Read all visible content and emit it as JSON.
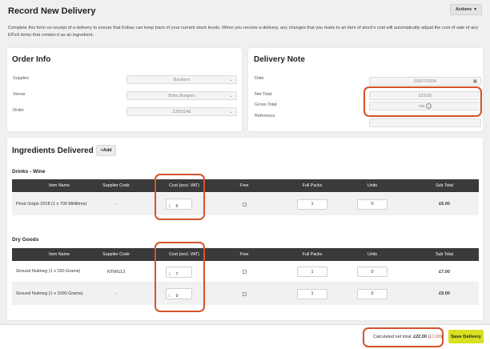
{
  "page": {
    "title": "Record New Delivery",
    "actions_label": "Actions",
    "intro": "Complete this form on receipt of a delivery to ensure that Kobas can keep track of your current stock levels. When you receive a delivery, any changes that you make to an item of stock's cost will automatically adjust the cost of sale of any EPoS items that contain it as an ingredient."
  },
  "order_info": {
    "title": "Order Info",
    "supplier_label": "Supplier",
    "supplier_value": "Bookers",
    "venue_label": "Venue",
    "venue_value": "Bobs Burgers",
    "order_label": "Order",
    "order_value": "2393/146"
  },
  "delivery_note": {
    "title": "Delivery Note",
    "date_label": "Date",
    "date_value": "03/07/2024",
    "net_total_label": "Net Total",
    "net_total_value": "£23.00",
    "gross_total_label": "Gross Total",
    "gross_total_value": "n/a",
    "reference_label": "Reference",
    "reference_value": ""
  },
  "ingredients": {
    "title": "Ingredients Delivered",
    "add_label": "+Add",
    "columns": [
      "Item Name",
      "Supplier Code",
      "Cost (excl. VAT)",
      "Free",
      "Full Packs",
      "Units",
      "Sub Total"
    ],
    "currency": "£",
    "sections": [
      {
        "title": "Drinks - Wine",
        "rows": [
          {
            "name": "Pinot Grigio 2018 (1 x 700 Millilitres)",
            "code": "-",
            "cost": "6",
            "packs": "1",
            "units": "0",
            "subtotal": "£6.00"
          }
        ]
      },
      {
        "title": "Dry Goods",
        "rows": [
          {
            "name": "Ground Nutmeg (1 x 150 Grams)",
            "code": "NTMG13",
            "cost": "7",
            "packs": "1",
            "units": "0",
            "subtotal": "£7.00"
          },
          {
            "name": "Ground Nutmeg (1 x 1000 Grams)",
            "code": "-",
            "cost": "9",
            "packs": "1",
            "units": "0",
            "subtotal": "£9.00"
          }
        ]
      }
    ]
  },
  "footer": {
    "net_total_label": "Calculated net total:",
    "net_total_value": "£22.00",
    "difference": "£1.00",
    "save_label": "Save Delivery"
  },
  "colors": {
    "highlight": "#d4532a",
    "save_button": "#d9e021",
    "table_header": "#3a3a3a"
  }
}
